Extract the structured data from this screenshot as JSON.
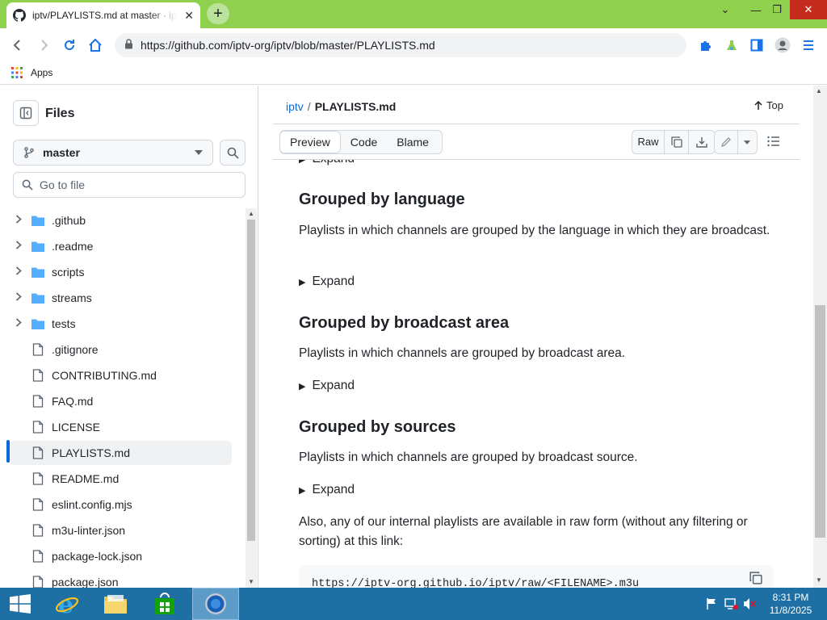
{
  "browser": {
    "tab_title": "iptv/PLAYLISTS.md at master · iptv-org/iptv",
    "tab_close": "✕",
    "new_tab": "+",
    "url": "https://github.com/iptv-org/iptv/blob/master/PLAYLISTS.md",
    "bookmarks": {
      "apps_label": "Apps"
    },
    "window_controls": {
      "chevron": "⌄",
      "minimize": "—",
      "restore": "❐",
      "close": "✕"
    }
  },
  "sidebar": {
    "title": "Files",
    "branch": "master",
    "go_to_file_placeholder": "Go to file",
    "tree": [
      {
        "name": ".github",
        "type": "folder"
      },
      {
        "name": ".readme",
        "type": "folder"
      },
      {
        "name": "scripts",
        "type": "folder"
      },
      {
        "name": "streams",
        "type": "folder"
      },
      {
        "name": "tests",
        "type": "folder"
      },
      {
        "name": ".gitignore",
        "type": "file"
      },
      {
        "name": "CONTRIBUTING.md",
        "type": "file"
      },
      {
        "name": "FAQ.md",
        "type": "file"
      },
      {
        "name": "LICENSE",
        "type": "file"
      },
      {
        "name": "PLAYLISTS.md",
        "type": "file",
        "selected": true
      },
      {
        "name": "README.md",
        "type": "file"
      },
      {
        "name": "eslint.config.mjs",
        "type": "file"
      },
      {
        "name": "m3u-linter.json",
        "type": "file"
      },
      {
        "name": "package-lock.json",
        "type": "file"
      },
      {
        "name": "package.json",
        "type": "file"
      }
    ]
  },
  "main": {
    "breadcrumb": {
      "repo": "iptv",
      "sep": "/",
      "file": "PLAYLISTS.md"
    },
    "top_label": "Top",
    "tabs": [
      "Preview",
      "Code",
      "Blame"
    ],
    "raw_label": "Raw",
    "content": {
      "partial_expand": "Expand",
      "sections": [
        {
          "heading": "Grouped by language",
          "text": "Playlists in which channels are grouped by the language in which they are broadcast.",
          "expand": "Expand"
        },
        {
          "heading": "Grouped by broadcast area",
          "text": "Playlists in which channels are grouped by broadcast area.",
          "expand": "Expand"
        },
        {
          "heading": "Grouped by sources",
          "text": "Playlists in which channels are grouped by broadcast source.",
          "expand": "Expand"
        }
      ],
      "also_text": "Also, any of our internal playlists are available in raw form (without any filtering or sorting) at this link:",
      "code": "https://iptv-org.github.io/iptv/raw/<FILENAME>.m3u"
    }
  },
  "taskbar": {
    "time": "8:31 PM",
    "date": "11/8/2025"
  },
  "colors": {
    "titlebar": "#8fd14f",
    "taskbar": "#1e6fa3",
    "link": "#0969da",
    "folder": "#54aeff"
  }
}
